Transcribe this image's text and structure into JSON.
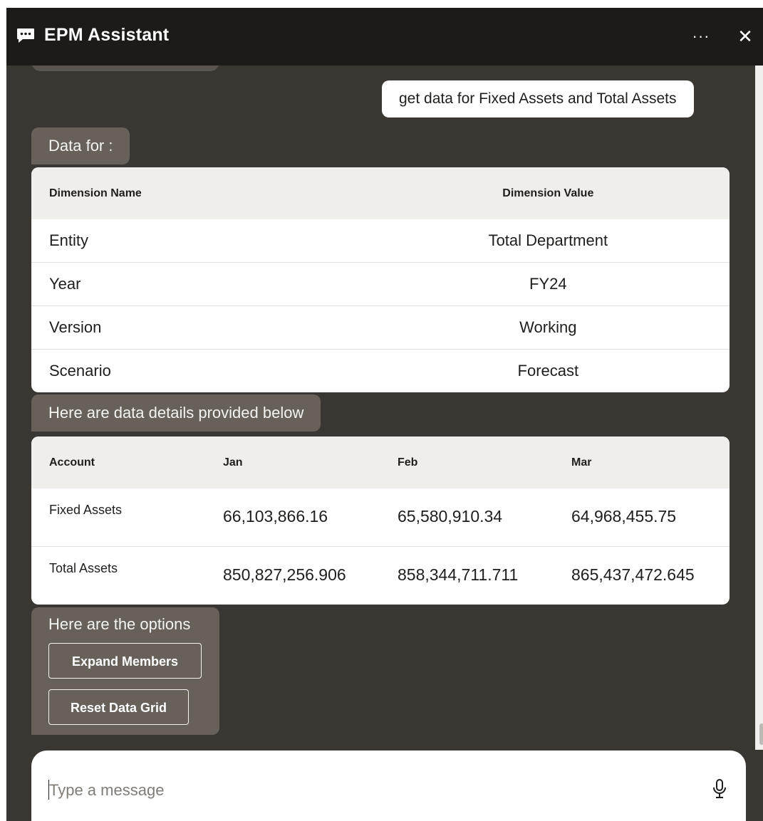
{
  "header": {
    "title": "EPM Assistant",
    "chat_icon": "chat-bubble-icon",
    "more_label": "···",
    "close_label": "✕"
  },
  "conversation": {
    "user_message": "get data for Fixed Assets and Total Assets",
    "dimensions_intro": "Data for :",
    "dimensions_table": {
      "headers": [
        "Dimension Name",
        "Dimension Value"
      ],
      "rows": [
        [
          "Entity",
          "Total Department"
        ],
        [
          "Year",
          "FY24"
        ],
        [
          "Version",
          "Working"
        ],
        [
          "Scenario",
          "Forecast"
        ]
      ]
    },
    "data_intro": "Here are data details provided below",
    "data_table": {
      "headers": [
        "Account",
        "Jan",
        "Feb",
        "Mar"
      ],
      "rows": [
        [
          "Fixed Assets",
          "66,103,866.16",
          "65,580,910.34",
          "64,968,455.75"
        ],
        [
          "Total Assets",
          "850,827,256.906",
          "858,344,711.711",
          "865,437,472.645"
        ]
      ]
    },
    "options": {
      "title": "Here are the options",
      "buttons": [
        "Expand Members",
        "Reset Data Grid"
      ]
    }
  },
  "composer": {
    "placeholder": "Type a message",
    "mic_icon": "microphone-icon"
  },
  "colors": {
    "header_bg": "#1c1b19",
    "panel_bg": "#3a3631",
    "bot_bubble": "#67615a",
    "user_bubble": "#ffffff"
  }
}
